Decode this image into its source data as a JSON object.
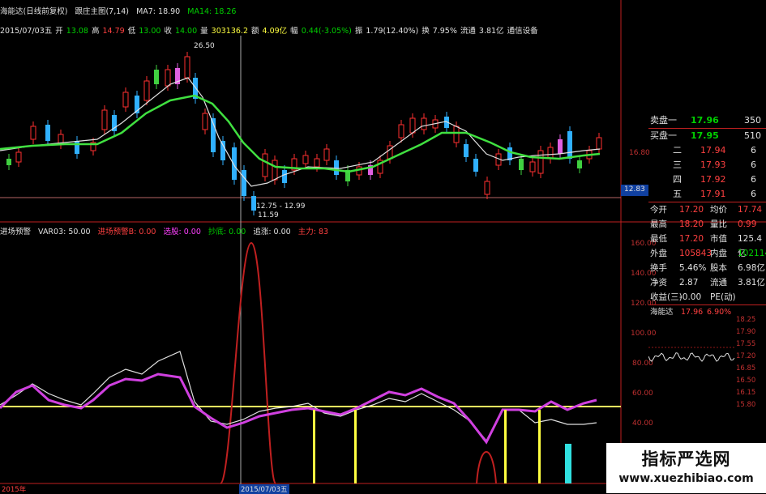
{
  "title_bar": {
    "stock": "海能达(日线前复权)",
    "indicator": "跟庄主图(7,14)",
    "ma7": "MA7: 18.90",
    "ma14": "MA14: 18.26"
  },
  "info_bar": {
    "date": "2015/07/03五",
    "open_label": "开",
    "open": "13.08",
    "high_label": "高",
    "high": "14.79",
    "low_label": "低",
    "low": "13.00",
    "close_label": "收",
    "close": "14.00",
    "volume_label": "量",
    "volume": "303136.2",
    "amount_label": "额",
    "amount": "4.09亿",
    "change_label": "幅",
    "change": "0.44(-3.05%)",
    "amplitude_label": "振",
    "amplitude": "1.79(12.40%)",
    "turnover_label": "换",
    "turnover": "7.95%",
    "float_label": "流通",
    "float": "3.81亿",
    "sector": "通信设备"
  },
  "price_annotations": {
    "peak": "26.50",
    "low_range": "12.75 - 12.99",
    "low": "11.59",
    "left_axis_price": "16.80",
    "right_axis_marker": "12.83"
  },
  "indicator_bar": {
    "name": "进场预警",
    "var03": "VAR03: 50.00",
    "entry_warning": "进场预警B: 0.00",
    "select_stock": "选股: 0.00",
    "sell": "抄底: 0.00",
    "follow": "追涨: 0.00",
    "main": "主力: 83"
  },
  "indicator_axis": [
    "160.00",
    "140.00",
    "120.00",
    "100.00",
    "80.00",
    "60.00",
    "40.00"
  ],
  "time_axis": {
    "year": "2015年",
    "cursor_date": "2015/07/03五"
  },
  "order_book": {
    "sell": [
      {
        "label": "卖盘一",
        "price": "17.96",
        "volume": "350"
      }
    ],
    "buy": [
      {
        "label": "买盘一",
        "price": "17.95",
        "volume": "510"
      },
      {
        "label": "二",
        "price": "17.94",
        "volume": "6"
      },
      {
        "label": "三",
        "price": "17.93",
        "volume": "6"
      },
      {
        "label": "四",
        "price": "17.92",
        "volume": "6"
      },
      {
        "label": "五",
        "price": "17.91",
        "volume": "6"
      }
    ]
  },
  "stats": [
    {
      "l1": "今开",
      "v1": "17.20",
      "l2": "均价",
      "v2": "17.74",
      "c1": "red",
      "c2": "red"
    },
    {
      "l1": "最高",
      "v1": "18.20",
      "l2": "量比",
      "v2": "0.99",
      "c1": "red",
      "c2": "red"
    },
    {
      "l1": "最低",
      "v1": "17.20",
      "l2": "市值",
      "v2": "125.4亿",
      "c1": "red",
      "c2": "white"
    },
    {
      "l1": "外盘",
      "v1": "105843",
      "l2": "内盘",
      "v2": "102114",
      "c1": "red",
      "c2": "green"
    },
    {
      "l1": "换手",
      "v1": "5.46%",
      "l2": "股本",
      "v2": "6.98亿",
      "c1": "white",
      "c2": "white"
    },
    {
      "l1": "净资",
      "v1": "2.87",
      "l2": "流通",
      "v2": "3.81亿",
      "c1": "white",
      "c2": "white"
    },
    {
      "l1": "收益(三)",
      "v1": "-0.00",
      "l2": "PE(动)",
      "v2": "",
      "c1": "white",
      "c2": "white"
    }
  ],
  "mini_chart": {
    "name": "海能达",
    "price": "17.96",
    "pct": "6.90%",
    "ticks": [
      "18.25",
      "17.90",
      "17.55",
      "17.20",
      "16.85",
      "16.50",
      "16.15",
      "15.80"
    ]
  },
  "watermark": {
    "title": "指标严选网",
    "url": "www.xuezhibiao.com"
  }
}
